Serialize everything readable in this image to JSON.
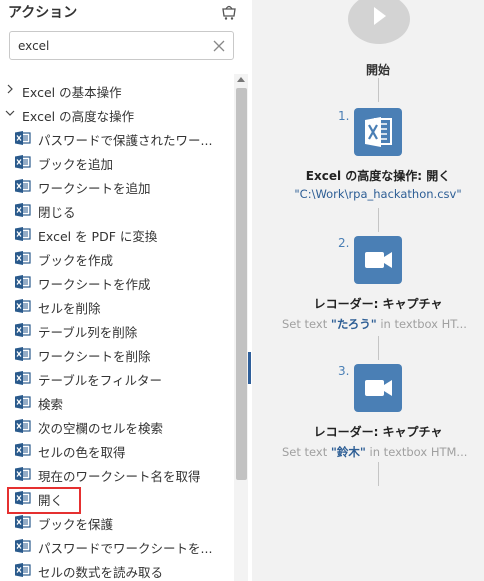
{
  "panel": {
    "title": "アクション",
    "search": {
      "value": "excel",
      "placeholder": ""
    }
  },
  "tree": {
    "groups": [
      {
        "label": "Excel の基本操作",
        "expanded": false
      },
      {
        "label": "Excel の高度な操作",
        "expanded": true
      }
    ],
    "items": [
      {
        "label": "パスワードで保護されたワー..."
      },
      {
        "label": "ブックを追加"
      },
      {
        "label": "ワークシートを追加"
      },
      {
        "label": "閉じる"
      },
      {
        "label": "Excel を PDF に変換"
      },
      {
        "label": "ブックを作成"
      },
      {
        "label": "ワークシートを作成"
      },
      {
        "label": "セルを削除"
      },
      {
        "label": "テーブル列を削除"
      },
      {
        "label": "ワークシートを削除"
      },
      {
        "label": "テーブルをフィルター"
      },
      {
        "label": "検索"
      },
      {
        "label": "次の空欄のセルを検索"
      },
      {
        "label": "セルの色を取得"
      },
      {
        "label": "現在のワークシート名を取得"
      },
      {
        "label": "開く",
        "selected": true
      },
      {
        "label": "ブックを保護"
      },
      {
        "label": "パスワードでワークシートを..."
      },
      {
        "label": "セルの数式を読み取る"
      }
    ]
  },
  "flow": {
    "start_label": "開始",
    "steps": [
      {
        "number": "1.",
        "icon": "excel-icon",
        "title": "Excel の高度な操作: 開く",
        "subtitle": "\"C:\\Work\\rpa_hackathon.csv\""
      },
      {
        "number": "2.",
        "icon": "video-camera-icon",
        "title": "レコーダー: キャプチャ",
        "sub_prefix": "Set text ",
        "sub_quote": "\"たろう\"",
        "sub_suffix": " in textbox HT..."
      },
      {
        "number": "3.",
        "icon": "video-camera-icon",
        "title": "レコーダー: キャプチャ",
        "sub_prefix": "Set text ",
        "sub_quote": "\"鈴木\"",
        "sub_suffix": " in textbox HTM..."
      }
    ]
  },
  "colors": {
    "accent": "#4a7fb5",
    "selection": "#e53030",
    "excel_icon": "#2a5a8c"
  }
}
